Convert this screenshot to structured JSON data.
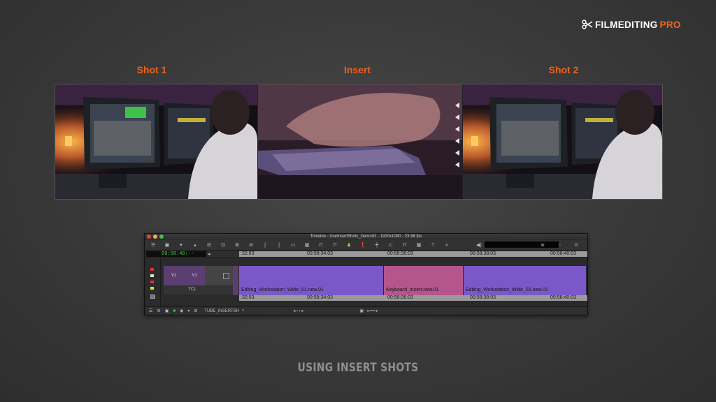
{
  "brand": {
    "prefix": "FILMEDITING",
    "accent": "PRO"
  },
  "shots": {
    "shot1": "Shot 1",
    "insert": "Insert",
    "shot2": "Shot 2"
  },
  "timeline": {
    "title": "Timeline - UseInsertShots_Demo02 - 1920x1080 - 23.98 fps",
    "timecode": "00:58:40:--",
    "ruler_top": [
      ":32:03",
      "00:58:34:03",
      "00:58:36:03",
      "00:58:38:03",
      "00:58:40:03"
    ],
    "ruler_bottom": [
      ":32:03",
      "00:58:34:03",
      "00:58:36:03",
      "00:58:38:03",
      "00:58:40:03"
    ],
    "track_source": "V1",
    "track_record": "V1",
    "tc_track": "TC1",
    "clips": [
      {
        "name": "Editing_Workstation_Wide_01.new.01",
        "color": "#7b58c8"
      },
      {
        "name": "Keyboard_Insert.new.01",
        "color": "#b4558e"
      },
      {
        "name": "Editing_Workstation_Wide_02.new.01",
        "color": "#7b58c8"
      }
    ],
    "bin_name": "TUBE_INSERTSH"
  },
  "caption": "USING INSERT SHOTS",
  "colors": {
    "accent": "#e8631e",
    "timecode": "#47d147",
    "clip_purple": "#7b58c8",
    "clip_pink": "#b4558e"
  }
}
